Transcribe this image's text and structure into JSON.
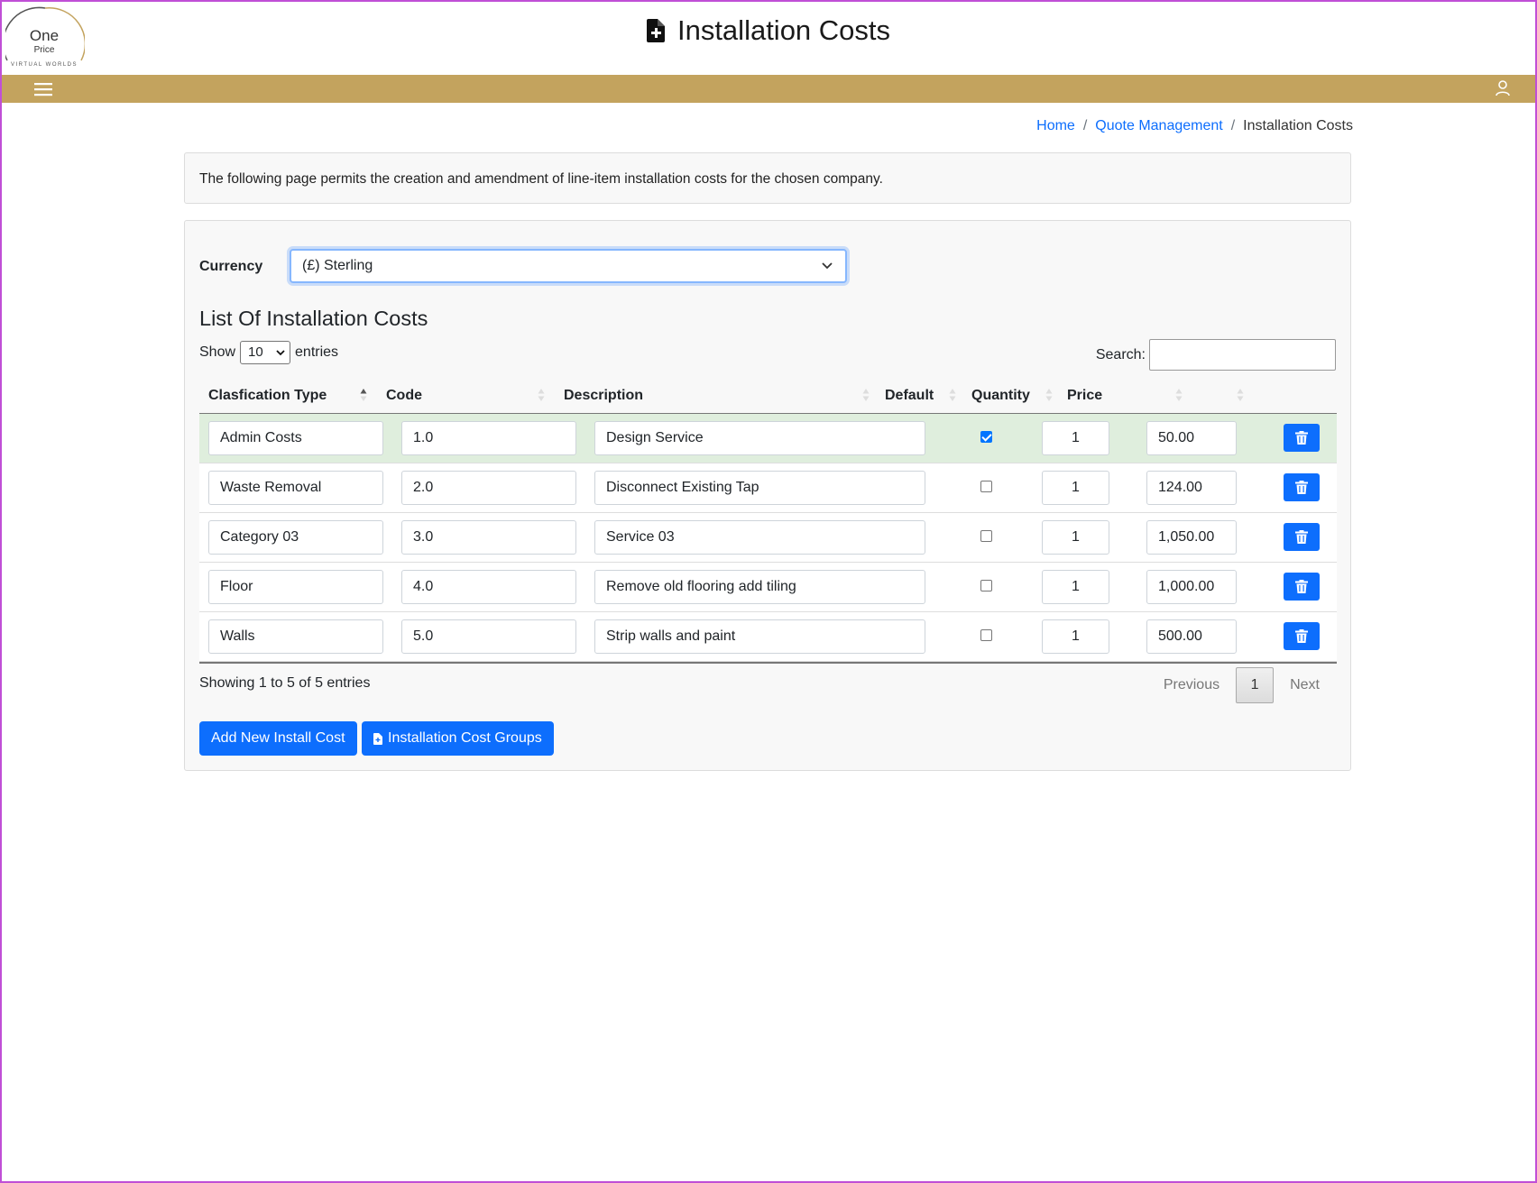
{
  "logo": {
    "line1": "One",
    "line2": "Price",
    "line3": "VIRTUAL WORLDS"
  },
  "page": {
    "title": "Installation Costs",
    "title_icon": "file-plus-icon"
  },
  "navbar": {
    "menu_icon": "hamburger-menu-icon",
    "user_icon": "user-icon",
    "color": "#c3a35e"
  },
  "breadcrumb": {
    "home": "Home",
    "quote_management": "Quote Management",
    "current": "Installation Costs",
    "separator": "/"
  },
  "info": {
    "text": "The following page permits the creation and amendment of line-item installation costs for the chosen company."
  },
  "currency": {
    "label": "Currency",
    "selected": "(£) Sterling"
  },
  "list": {
    "title": "List Of Installation Costs",
    "show_label": "Show",
    "entries_label": "entries",
    "page_length": "10",
    "search_label": "Search:",
    "search_value": ""
  },
  "table": {
    "headers": {
      "type": "Clasfication Type",
      "code": "Code",
      "description": "Description",
      "default": "Default",
      "quantity": "Quantity",
      "price": "Price"
    },
    "rows": [
      {
        "type": "Admin Costs",
        "code": "1.0",
        "description": "Design Service",
        "default": true,
        "quantity": "1",
        "price": "50.00"
      },
      {
        "type": "Waste Removal",
        "code": "2.0",
        "description": "Disconnect Existing Tap",
        "default": false,
        "quantity": "1",
        "price": "124.00"
      },
      {
        "type": "Category 03",
        "code": "3.0",
        "description": "Service 03",
        "default": false,
        "quantity": "1",
        "price": "1,050.00"
      },
      {
        "type": "Floor",
        "code": "4.0",
        "description": "Remove old flooring add tiling",
        "default": false,
        "quantity": "1",
        "price": "1,000.00"
      },
      {
        "type": "Walls",
        "code": "5.0",
        "description": "Strip walls and paint",
        "default": false,
        "quantity": "1",
        "price": "500.00"
      }
    ]
  },
  "footer": {
    "showing": "Showing 1 to 5 of 5 entries",
    "previous": "Previous",
    "current_page": "1",
    "next": "Next"
  },
  "buttons": {
    "add_new": "Add New Install Cost",
    "groups": "Installation Cost Groups"
  },
  "colors": {
    "primary": "#0d6efd",
    "highlight_row": "#dfeedd"
  }
}
